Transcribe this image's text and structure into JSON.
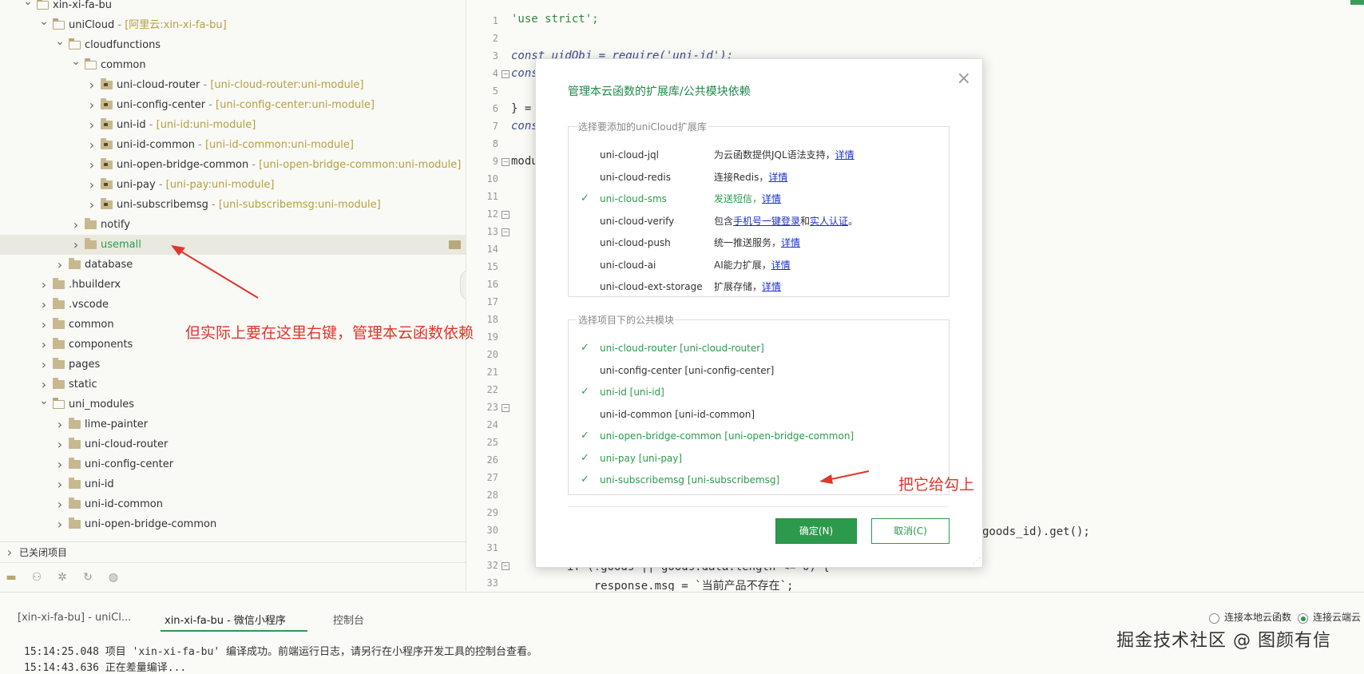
{
  "explorer": {
    "rows": [
      {
        "name": "xin-xi-fa-bu",
        "suffix": "",
        "state": "open"
      },
      {
        "name": "uniCloud",
        "suffix": "[阿里云:xin-xi-fa-bu]",
        "state": "open"
      },
      {
        "name": "cloudfunctions",
        "suffix": "",
        "state": "open"
      },
      {
        "name": "common",
        "suffix": "",
        "state": "open"
      },
      {
        "name": "uni-cloud-router",
        "suffix": "[uni-cloud-router:uni-module]",
        "state": "closed"
      },
      {
        "name": "uni-config-center",
        "suffix": "[uni-config-center:uni-module]",
        "state": "closed"
      },
      {
        "name": "uni-id",
        "suffix": "[uni-id:uni-module]",
        "state": "closed"
      },
      {
        "name": "uni-id-common",
        "suffix": "[uni-id-common:uni-module]",
        "state": "closed"
      },
      {
        "name": "uni-open-bridge-common",
        "suffix": "[uni-open-bridge-common:uni-module]",
        "state": "closed"
      },
      {
        "name": "uni-pay",
        "suffix": "[uni-pay:uni-module]",
        "state": "closed"
      },
      {
        "name": "uni-subscribemsg",
        "suffix": "[uni-subscribemsg:uni-module]",
        "state": "closed"
      },
      {
        "name": "notify",
        "suffix": "",
        "state": "closed"
      },
      {
        "name": "usemall",
        "suffix": "",
        "state": "closed",
        "selected": true
      },
      {
        "name": "database",
        "suffix": "",
        "state": "closed"
      },
      {
        "name": ".hbuilderx",
        "suffix": "",
        "state": "closed"
      },
      {
        "name": ".vscode",
        "suffix": "",
        "state": "closed"
      },
      {
        "name": "common",
        "suffix": "",
        "state": "closed"
      },
      {
        "name": "components",
        "suffix": "",
        "state": "closed"
      },
      {
        "name": "pages",
        "suffix": "",
        "state": "closed"
      },
      {
        "name": "static",
        "suffix": "",
        "state": "closed"
      },
      {
        "name": "uni_modules",
        "suffix": "",
        "state": "open"
      },
      {
        "name": "lime-painter",
        "suffix": "",
        "state": "closed"
      },
      {
        "name": "uni-cloud-router",
        "suffix": "",
        "state": "closed"
      },
      {
        "name": "uni-config-center",
        "suffix": "",
        "state": "closed"
      },
      {
        "name": "uni-id",
        "suffix": "",
        "state": "closed"
      },
      {
        "name": "uni-id-common",
        "suffix": "",
        "state": "closed"
      },
      {
        "name": "uni-open-bridge-common",
        "suffix": "",
        "state": "closed"
      }
    ],
    "closed_projects": "已关闭项目"
  },
  "editor": {
    "lines": {
      "1": "'use strict';",
      "3": "const uidObj = require('uni-id');",
      "4": "cons",
      "6": "} =",
      "7": "cons",
      "9": "modu",
      "30": "goods_id).get();",
      "32": "if (!goods || goods.data.length <= 0) {",
      "33": "    response.msg = `当前产品不存在`;"
    }
  },
  "modal": {
    "title": "管理本云函数的扩展库/公共模块依赖",
    "ext_legend": "选择要添加的uniCloud扩展库",
    "ext_items": [
      {
        "name": "uni-cloud-jql",
        "desc": "为云函数提供JQL语法支持，",
        "link": "详情",
        "checked": false
      },
      {
        "name": "uni-cloud-redis",
        "desc": "连接Redis，",
        "link": "详情",
        "checked": false
      },
      {
        "name": "uni-cloud-sms",
        "desc": "发送短信，",
        "link": "详情",
        "checked": true
      },
      {
        "name": "uni-cloud-verify",
        "desc": "包含",
        "link": "手机号一键登录",
        "desc2": "和",
        "link2": "实人认证",
        "desc3": "。",
        "checked": false
      },
      {
        "name": "uni-cloud-push",
        "desc": "统一推送服务，",
        "link": "详情",
        "checked": false
      },
      {
        "name": "uni-cloud-ai",
        "desc": "AI能力扩展，",
        "link": "详情",
        "checked": false
      },
      {
        "name": "uni-cloud-ext-storage",
        "desc": "扩展存储，",
        "link": "详情",
        "checked": false
      }
    ],
    "mod_legend": "选择项目下的公共模块",
    "mod_items": [
      {
        "name": "uni-cloud-router [uni-cloud-router]",
        "checked": true
      },
      {
        "name": "uni-config-center [uni-config-center]",
        "checked": false
      },
      {
        "name": "uni-id [uni-id]",
        "checked": true
      },
      {
        "name": "uni-id-common [uni-id-common]",
        "checked": false
      },
      {
        "name": "uni-open-bridge-common [uni-open-bridge-common]",
        "checked": true
      },
      {
        "name": "uni-pay [uni-pay]",
        "checked": true
      },
      {
        "name": "uni-subscribemsg [uni-subscribemsg]",
        "checked": true
      }
    ],
    "confirm": "确定(N)",
    "cancel": "取消(C)"
  },
  "annotations": {
    "left": "但实际上要在这里右键，管理本云函数依赖",
    "right": "把它给勾上"
  },
  "console": {
    "tabs": [
      "[xin-xi-fa-bu] - uniCl...",
      "xin-xi-fa-bu - 微信小程序",
      "控制台"
    ],
    "radio_local": "连接本地云函数",
    "radio_cloud": "连接云端云",
    "logs": [
      "15:14:25.048 项目 'xin-xi-fa-bu' 编译成功。前端运行日志，请另行在小程序开发工具的控制台查看。",
      "15:14:43.636 正在差量编译..."
    ]
  },
  "watermark": "掘金技术社区 @ 图颜有信",
  "colors": {
    "accent": "#2c9a4c",
    "annotation": "#e2352b",
    "link": "#1a2fd0"
  }
}
